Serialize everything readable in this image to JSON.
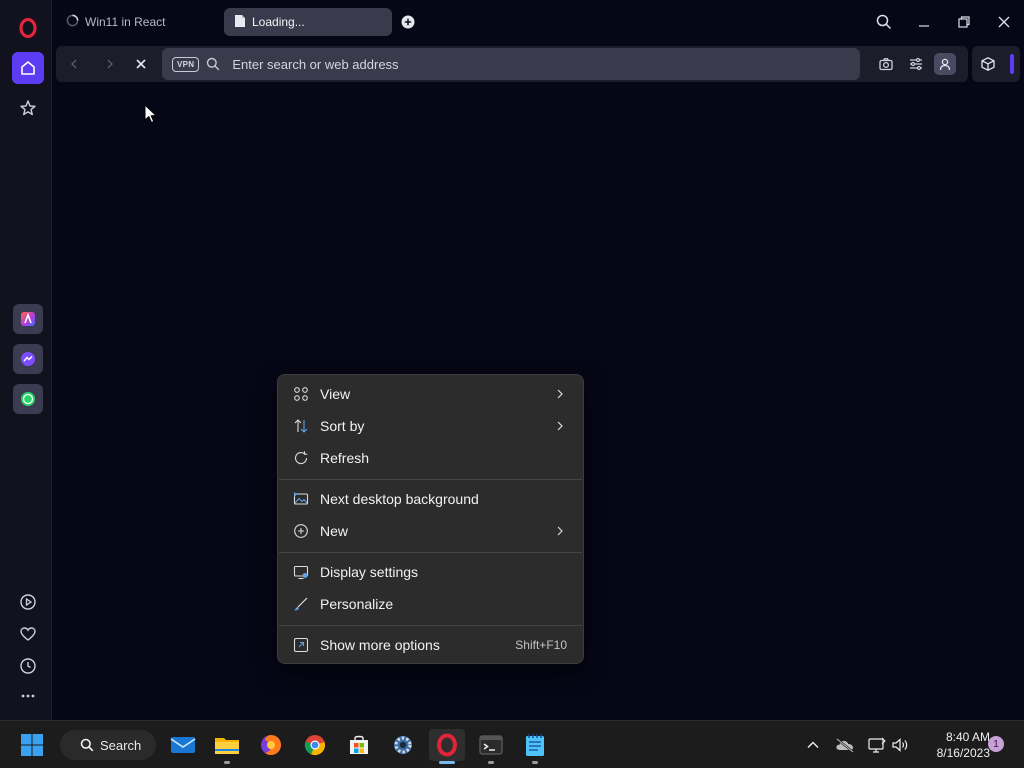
{
  "browser": {
    "tabs": [
      {
        "title": "Win11 in React",
        "icon": "loading-spinner-icon"
      },
      {
        "title": "Loading...",
        "icon": "document-icon"
      }
    ],
    "new_tab_icon": "plus-icon",
    "address_bar": {
      "vpn_label": "VPN",
      "placeholder": "Enter search or web address"
    },
    "accent_color": "#5b3cf2"
  },
  "sidebar": {
    "items": [
      "home-icon",
      "star-icon",
      "aria-icon",
      "messenger-icon",
      "whatsapp-icon",
      "player-icon",
      "heart-icon",
      "history-icon",
      "more-icon"
    ]
  },
  "context_menu": {
    "items": [
      {
        "label": "View",
        "icon": "grid-icon",
        "submenu": true
      },
      {
        "label": "Sort by",
        "icon": "sort-icon",
        "submenu": true
      },
      {
        "label": "Refresh",
        "icon": "refresh-icon",
        "submenu": false
      },
      {
        "label": "Next desktop background",
        "icon": "desktop-background-icon",
        "submenu": false
      },
      {
        "label": "New",
        "icon": "new-plus-icon",
        "submenu": true
      },
      {
        "label": "Display settings",
        "icon": "display-settings-icon",
        "submenu": false
      },
      {
        "label": "Personalize",
        "icon": "brush-icon",
        "submenu": false
      },
      {
        "label": "Show more options",
        "icon": "more-options-icon",
        "submenu": false,
        "shortcut": "Shift+F10"
      }
    ]
  },
  "taskbar": {
    "search_label": "Search",
    "apps": [
      "start-icon",
      "mail-icon",
      "file-explorer-icon",
      "firefox-icon",
      "chrome-icon",
      "store-icon",
      "settings-icon",
      "opera-icon",
      "terminal-icon",
      "notepad-icon"
    ],
    "clock": {
      "time": "8:40 AM",
      "date": "8/16/2023"
    },
    "notification_count": "1"
  }
}
